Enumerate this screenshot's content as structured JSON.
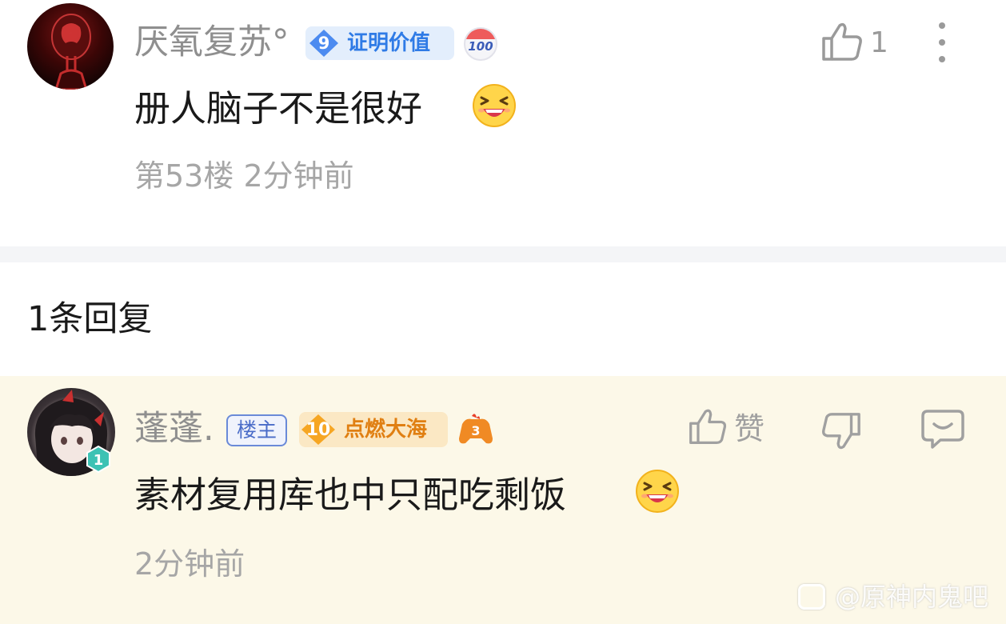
{
  "main_comment": {
    "username": "厌氧复苏°",
    "level": "9",
    "badge_label": "证明价值",
    "badge_100": "100",
    "text": "册人脑子不是很好",
    "floor": "第53楼",
    "time": "2分钟前",
    "likes": "1"
  },
  "reply_count_label": "1条回复",
  "reply": {
    "username": "蓬蓬.",
    "op_tag": "楼主",
    "level": "10",
    "badge_label": "点燃大海",
    "avatar_level": "1",
    "text": "素材复用库也中只配吃剩饭",
    "time": "2分钟前",
    "like_label": "赞"
  },
  "watermark": {
    "text": "@原神内鬼吧"
  },
  "colors": {
    "background": "#ffffff",
    "reply_background": "#fcf8e8",
    "username_gray": "#8f8f8f",
    "badge_blue": "#2f7be6",
    "badge_orange": "#e07f12",
    "op_tag_blue": "#4a6cc8"
  },
  "icons": [
    "thumbs-up-icon",
    "more-vertical-icon",
    "thumbs-down-icon",
    "reply-bubble-icon",
    "laughing-emoji-icon",
    "gamepad-fire-icon",
    "calendar-100-icon",
    "level-diamond-icon",
    "level-hexagon-icon"
  ]
}
